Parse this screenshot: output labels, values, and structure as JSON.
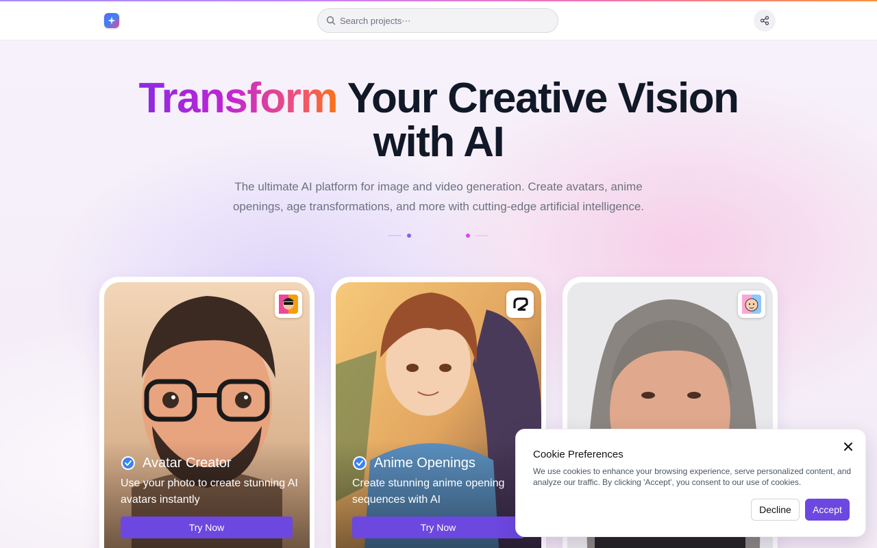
{
  "header": {
    "search_placeholder": "Search projects⋯"
  },
  "hero": {
    "title_highlight": "Transform",
    "title_rest_line1": " Your Creative Vision",
    "title_line2": "with AI",
    "subtitle_line1": "The ultimate AI platform for image and video generation. Create avatars, anime",
    "subtitle_line2": "openings, age transformations, and more with cutting-edge artificial intelligence."
  },
  "cards": [
    {
      "title": "Avatar Creator",
      "description": "Use your photo to create stunning AI avatars instantly",
      "button": "Try Now",
      "icon": "avatar-emoji-icon"
    },
    {
      "title": "Anime Openings",
      "description": "Create stunning anime opening sequences with AI",
      "button": "Try Now",
      "icon": "anime-logo-icon"
    },
    {
      "title": "",
      "description": "",
      "button": "",
      "icon": "age-face-icon"
    }
  ],
  "cookie": {
    "title": "Cookie Preferences",
    "body": "We use cookies to enhance your browsing experience, serve personalized content, and analyze our traffic. By clicking 'Accept', you consent to our use of cookies.",
    "decline": "Decline",
    "accept": "Accept"
  },
  "colors": {
    "accent": "#6c47e0",
    "gradient_start": "#8b2be2",
    "gradient_end": "#f97316"
  }
}
